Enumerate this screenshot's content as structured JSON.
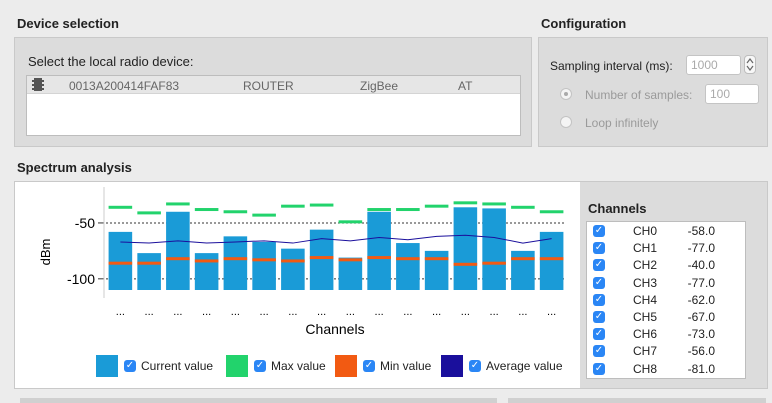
{
  "device_selection": {
    "title": "Device selection",
    "prompt": "Select the local radio device:",
    "devices": [
      {
        "address": "0013A200414FAF83",
        "role": "ROUTER",
        "protocol": "ZigBee",
        "mode": "AT"
      }
    ]
  },
  "configuration": {
    "title": "Configuration",
    "sampling_label": "Sampling interval (ms):",
    "sampling_value": "1000",
    "num_samples_label": "Number of samples:",
    "num_samples_value": "100",
    "loop_label": "Loop infinitely",
    "selected_option": "Number of samples"
  },
  "spectrum": {
    "title": "Spectrum analysis",
    "channels_title": "Channels",
    "channels": [
      {
        "name": "CH0",
        "value": "-58.0"
      },
      {
        "name": "CH1",
        "value": "-77.0"
      },
      {
        "name": "CH2",
        "value": "-40.0"
      },
      {
        "name": "CH3",
        "value": "-77.0"
      },
      {
        "name": "CH4",
        "value": "-62.0"
      },
      {
        "name": "CH5",
        "value": "-67.0"
      },
      {
        "name": "CH6",
        "value": "-73.0"
      },
      {
        "name": "CH7",
        "value": "-56.0"
      },
      {
        "name": "CH8",
        "value": "-81.0"
      }
    ],
    "legend": {
      "current": "Current value",
      "max": "Max value",
      "min": "Min value",
      "avg": "Average value"
    }
  },
  "colors": {
    "current": "#1a9bd7",
    "max": "#22d36c",
    "min": "#f25a12",
    "avg": "#1a0f9c",
    "checkbox": "#2a86f5"
  },
  "chart_data": {
    "type": "bar",
    "xlabel": "Channels",
    "ylabel": "dBm",
    "ylim": [
      -110,
      -25
    ],
    "yticks": [
      -50,
      -100
    ],
    "categories": [
      "...",
      "...",
      "...",
      "...",
      "...",
      "...",
      "...",
      "...",
      "...",
      "...",
      "...",
      "...",
      "...",
      "...",
      "...",
      "..."
    ],
    "series": [
      {
        "name": "Current value",
        "values": [
          -58,
          -77,
          -40,
          -77,
          -62,
          -67,
          -73,
          -56,
          -81,
          -40,
          -68,
          -75,
          -36,
          -37,
          -75,
          -58
        ]
      },
      {
        "name": "Max value",
        "values": [
          -36,
          -41,
          -33,
          -38,
          -40,
          -43,
          -35,
          -34,
          -49,
          -38,
          -38,
          -35,
          -32,
          -33,
          -36,
          -40
        ]
      },
      {
        "name": "Min value",
        "values": [
          -86,
          -86,
          -82,
          -84,
          -82,
          -83,
          -84,
          -81,
          -83,
          -81,
          -82,
          -82,
          -87,
          -86,
          -82,
          -82
        ]
      },
      {
        "name": "Average value",
        "values": [
          -67,
          -68,
          -66,
          -68,
          -67,
          -66,
          -68,
          -64,
          -66,
          -63,
          -65,
          -62,
          -61,
          -63,
          -68,
          -64
        ]
      }
    ]
  }
}
